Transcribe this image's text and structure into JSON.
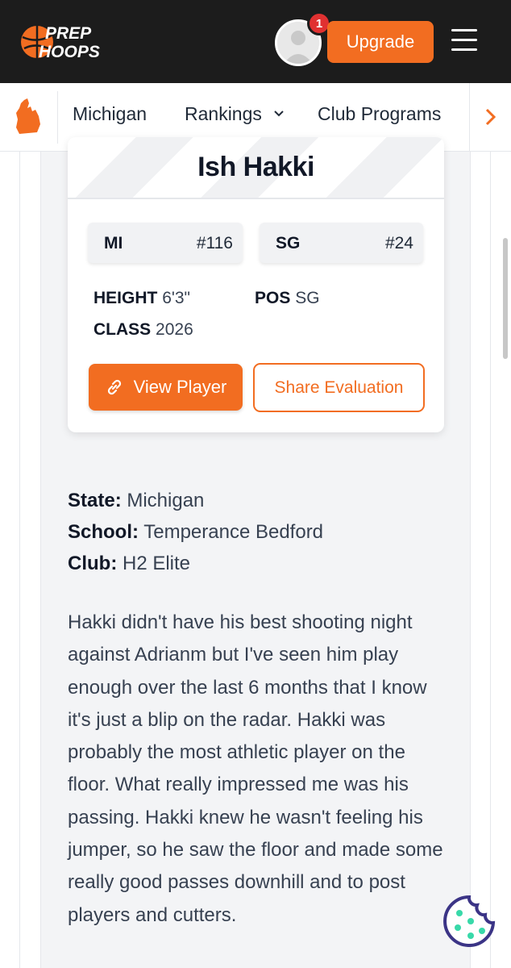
{
  "header": {
    "logo_top": "PREP",
    "logo_bottom": "HOOPS",
    "notification_count": "1",
    "upgrade_label": "Upgrade",
    "brand_color": "#f26d21"
  },
  "subnav": {
    "state_icon": "michigan-map-icon",
    "items": [
      "Michigan",
      "Rankings",
      "Club Programs"
    ],
    "rankings_chevron": "⌄",
    "next_icon": "chevron-right-icon"
  },
  "player": {
    "name": "Ish Hakki",
    "state_rank_label": "MI",
    "state_rank_value": "#116",
    "position_rank_label": "SG",
    "position_rank_value": "#24",
    "height_label": "HEIGHT",
    "height_value": "6'3\"",
    "pos_label": "POS",
    "pos_value": "SG",
    "class_label": "CLASS",
    "class_value": "2026",
    "view_player_label": "View Player",
    "share_label": "Share Evaluation"
  },
  "details": {
    "state_label": "State:",
    "state_value": "Michigan",
    "school_label": "School:",
    "school_value": "Temperance Bedford",
    "club_label": "Club:",
    "club_value": "H2 Elite"
  },
  "evaluation": {
    "text": "Hakki didn't have his best shooting night against Adrianm but I've seen him play enough over the last 6 months that I know it's just a blip on the radar. Hakki was probably the most athletic player on the floor. What really impressed me was his passing. Hakki knew he wasn't feeling his jumper, so he saw the floor and made some really good passes downhill and to post players and cutters."
  },
  "cookie": {
    "icon": "cookie-icon",
    "color": "#3b3486"
  }
}
